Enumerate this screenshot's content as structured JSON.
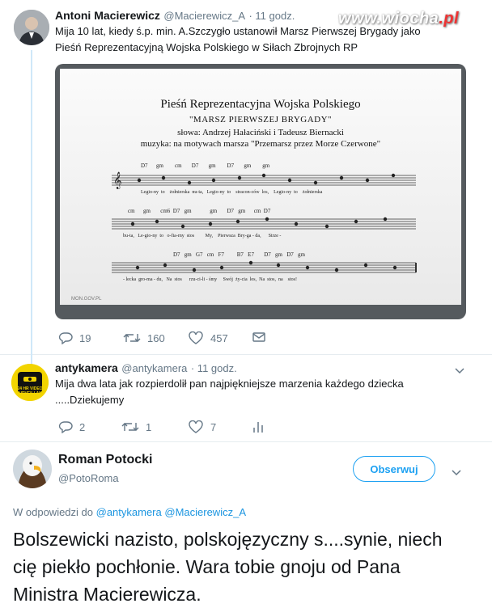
{
  "watermark": {
    "site": "www.wiocha",
    "tld": ".pl"
  },
  "tweet1": {
    "author": "Antoni Macierewicz",
    "handle": "@Macierewicz_A",
    "time": "· 11 godz.",
    "text_line1": "Mija 10 lat, kiedy ś.p. min. A.Szczygło ustanowił Marsz Pierwszej Brygady jako",
    "text_line2": "Pieśń Reprezentacyjną Wojska Polskiego w Siłach Zbrojnych RP",
    "image": {
      "title": "Pieśń Reprezentacyjna Wojska Polskiego",
      "subtitle": "\"MARSZ PIERWSZEJ BRYGADY\"",
      "credit_words": "słowa: Andrzej Hałaciński i Tadeusz Biernacki",
      "credit_music": "muzyka: na motywach marsza \"Przemarsz przez Morze Czerwone\"",
      "source": "MON.GOV.PL",
      "staff1_lyrics": "Legio-ny  to    żołnierska  nu-ta,   Legio-ny  to    stracon-ców  los,    Legio-ny  to    żołnierska",
      "staff2_lyrics": "bu-ta,   Le-gio-ny  to   o-fia-rny  stos         My,    Pierwsza  Bry-ga - da,      Strze -",
      "staff3_lyrics": "- lecka  gro-ma - du,   Na  stos      rzu-ci-li - śmy     Swój  ży-cia  los,  Na  stos,  na    stos!",
      "staff1_chords": "D7      gm        cm       D7       gm        D7       gm        gm",
      "staff2_chords": "cm      gm       cm6  D7   gm             gm       D7   gm      cm  D7",
      "staff3_chords": "D7   gm   G7   cm   F7         B7   E7       D7   gm   D7   gm"
    },
    "stats": {
      "replies": "19",
      "retweets": "160",
      "likes": "457"
    }
  },
  "tweet2": {
    "author": "antykamera",
    "handle": "@antykamera",
    "time": "· 11 godz.",
    "avatar_text": "24 HR VIDEO SURVEILLANCE",
    "text_line1": "Mija dwa lata jak rozpierdolił pan najpiękniejsze marzenia każdego dziecka",
    "text_line2": ".....Dziekujemy",
    "stats": {
      "replies": "2",
      "retweets": "1",
      "likes": "7"
    }
  },
  "tweet3": {
    "author": "Roman Potocki",
    "handle": "@PotoRoma",
    "follow_label": "Obserwuj",
    "reply_prefix": "W odpowiedzi do",
    "reply_to1": "@antykamera",
    "reply_to2": "@Macierewicz_A",
    "text": "Bolszewicki nazisto, polskojęzyczny s....synie, niech cię piekło pochłonie. Wara tobie gnoju od Pana Ministra Macierewicza."
  },
  "colors": {
    "accent": "#1da1f2",
    "thread": "#cfe8f9",
    "muted": "#657786"
  }
}
